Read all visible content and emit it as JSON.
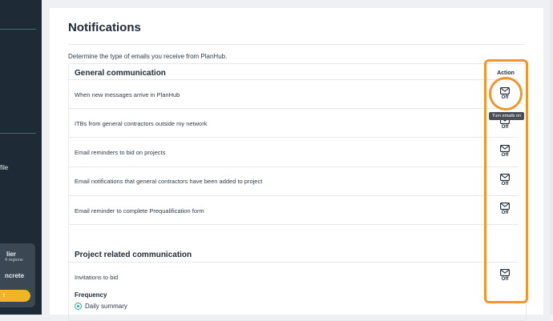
{
  "sidebar": {
    "profile_partial": "file",
    "card_line1": "lier",
    "card_line2": "4 regions",
    "card_line3": "ncrete",
    "card_button": "t"
  },
  "page": {
    "title": "Notifications",
    "subtitle": "Determine the type of emails you receive from PlanHub.",
    "action_header": "Action",
    "tooltip": "Turn emails on"
  },
  "general": {
    "heading": "General communication",
    "rows": [
      {
        "label": "When new messages arrive in PlanHub",
        "state": "Off"
      },
      {
        "label": "ITBs from general contractors outside my network",
        "state": "Off"
      },
      {
        "label": "Email reminders to bid on projects",
        "state": "Off"
      },
      {
        "label": "Email notifications that general contractors have been added to project",
        "state": "Off"
      },
      {
        "label": "Email reminder to complete Prequalification form",
        "state": "Off"
      }
    ]
  },
  "project": {
    "heading": "Project related communication",
    "rows": [
      {
        "label": "Invitations to bid",
        "state": "Off"
      }
    ],
    "frequency_label": "Frequency",
    "frequency_option": "Daily summary"
  },
  "colors": {
    "highlight": "#f0962e",
    "accent": "#1fae8c",
    "sidebar_bg": "#1e2b36"
  }
}
